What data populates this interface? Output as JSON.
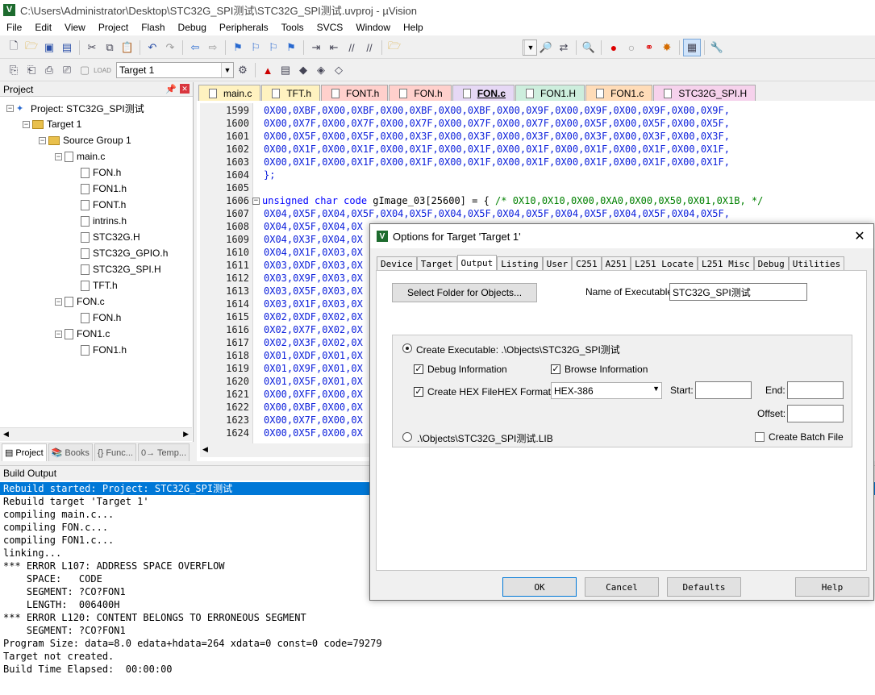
{
  "window": {
    "title": "C:\\Users\\Administrator\\Desktop\\STC32G_SPI测试\\STC32G_SPI测试.uvproj - µVision",
    "app_icon": "V"
  },
  "menu": [
    "File",
    "Edit",
    "View",
    "Project",
    "Flash",
    "Debug",
    "Peripherals",
    "Tools",
    "SVCS",
    "Window",
    "Help"
  ],
  "toolbar2": {
    "target_value": "Target 1"
  },
  "project": {
    "header": "Project",
    "tree": {
      "root": "Project: STC32G_SPI测试",
      "target": "Target 1",
      "group": "Source Group 1",
      "files": [
        "main.c",
        "FON.h",
        "FON1.h",
        "FONT.h",
        "intrins.h",
        "STC32G.H",
        "STC32G_GPIO.h",
        "STC32G_SPI.H",
        "TFT.h",
        "FON.c",
        "FON.h",
        "FON1.c",
        "FON1.h"
      ]
    },
    "tabs": [
      "Project",
      "Books",
      "{} Func...",
      "0→ Temp..."
    ]
  },
  "editor": {
    "tabs": [
      {
        "label": "main.c",
        "color": "#fff2c0"
      },
      {
        "label": "TFT.h",
        "color": "#fff2c0"
      },
      {
        "label": "FONT.h",
        "color": "#ffd0cc"
      },
      {
        "label": "FON.h",
        "color": "#ffd0cc"
      },
      {
        "label": "FON.c",
        "color": "#e6d8f5"
      },
      {
        "label": "FON1.H",
        "color": "#cdeedd"
      },
      {
        "label": "FON1.c",
        "color": "#ffdcb8"
      },
      {
        "label": "STC32G_SPI.H",
        "color": "#f6d2ec"
      }
    ],
    "active_tab": "FON.c",
    "line_numbers": [
      "1599",
      "1600",
      "1601",
      "1602",
      "1603",
      "1604",
      "1605",
      "1606",
      "1607",
      "1608",
      "1609",
      "1610",
      "1611",
      "1612",
      "1613",
      "1614",
      "1615",
      "1616",
      "1617",
      "1618",
      "1619",
      "1620",
      "1621",
      "1622",
      "1623",
      "1624"
    ],
    "lines": [
      "0X00,0XBF,0X00,0XBF,0X00,0XBF,0X00,0XBF,0X00,0X9F,0X00,0X9F,0X00,0X9F,0X00,0X9F,",
      "0X00,0X7F,0X00,0X7F,0X00,0X7F,0X00,0X7F,0X00,0X7F,0X00,0X5F,0X00,0X5F,0X00,0X5F,",
      "0X00,0X5F,0X00,0X5F,0X00,0X3F,0X00,0X3F,0X00,0X3F,0X00,0X3F,0X00,0X3F,0X00,0X3F,",
      "0X00,0X1F,0X00,0X1F,0X00,0X1F,0X00,0X1F,0X00,0X1F,0X00,0X1F,0X00,0X1F,0X00,0X1F,",
      "0X00,0X1F,0X00,0X1F,0X00,0X1F,0X00,0X1F,0X00,0X1F,0X00,0X1F,0X00,0X1F,0X00,0X1F,",
      "};",
      "",
      "",
      "0X04,0X5F,0X04,0X5F,0X04,0X5F,0X04,0X5F,0X04,0X5F,0X04,0X5F,0X04,0X5F,0X04,0X5F,",
      "0X04,0X5F,0X04,0X",
      "0X04,0X3F,0X04,0X",
      "0X04,0X1F,0X03,0X",
      "0X03,0XDF,0X03,0X",
      "0X03,0X9F,0X03,0X",
      "0X03,0X5F,0X03,0X",
      "0X03,0X1F,0X03,0X",
      "0X02,0XDF,0X02,0X",
      "0X02,0X7F,0X02,0X",
      "0X02,0X3F,0X02,0X",
      "0X01,0XDF,0X01,0X",
      "0X01,0X9F,0X01,0X",
      "0X01,0X5F,0X01,0X",
      "0X00,0XFF,0X00,0X",
      "0X00,0XBF,0X00,0X",
      "0X00,0X7F,0X00,0X",
      "0X00,0X5F,0X00,0X"
    ],
    "decl": {
      "kw1": "unsigned",
      "kw2": "char",
      "kw3": "code",
      "ident": " gImage_03[25600] = { ",
      "comment": "/* 0X10,0X10,0X00,0XA0,0X00,0X50,0X01,0X1B, */"
    }
  },
  "build": {
    "header": "Build Output",
    "highlight_color": "#0078d7",
    "lines": [
      "Rebuild started: Project: STC32G_SPI测试",
      "Rebuild target 'Target 1'",
      "compiling main.c...",
      "compiling FON.c...",
      "compiling FON1.c...",
      "linking...",
      "*** ERROR L107: ADDRESS SPACE OVERFLOW",
      "    SPACE:   CODE",
      "    SEGMENT: ?CO?FON1",
      "    LENGTH:  006400H",
      "*** ERROR L120: CONTENT BELONGS TO ERRONEOUS SEGMENT",
      "    SEGMENT: ?CO?FON1",
      "Program Size: data=8.0 edata+hdata=264 xdata=0 const=0 code=79279",
      "Target not created.",
      "Build Time Elapsed:  00:00:00"
    ]
  },
  "dialog": {
    "title": "Options for Target 'Target 1'",
    "tabs": [
      "Device",
      "Target",
      "Output",
      "Listing",
      "User",
      "C251",
      "A251",
      "L251 Locate",
      "L251 Misc",
      "Debug",
      "Utilities"
    ],
    "active_tab": "Output",
    "select_folder_btn": "Select Folder for Objects...",
    "name_exec_label": "Name of Executable:",
    "name_exec_value": "STC32G_SPI测试",
    "create_exec_label": "Create Executable:  .\\Objects\\STC32G_SPI测试",
    "debug_info": "Debug Information",
    "browse_info": "Browse Information",
    "create_hex": "Create HEX File",
    "hex_format_label": "HEX Format:",
    "hex_format_value": "HEX-386",
    "start_label": "Start:",
    "end_label": "End:",
    "offset_label": "Offset:",
    "lib_label": ".\\Objects\\STC32G_SPI测试.LIB",
    "batch_label": "Create Batch File",
    "ok": "OK",
    "cancel": "Cancel",
    "defaults": "Defaults",
    "help": "Help"
  }
}
